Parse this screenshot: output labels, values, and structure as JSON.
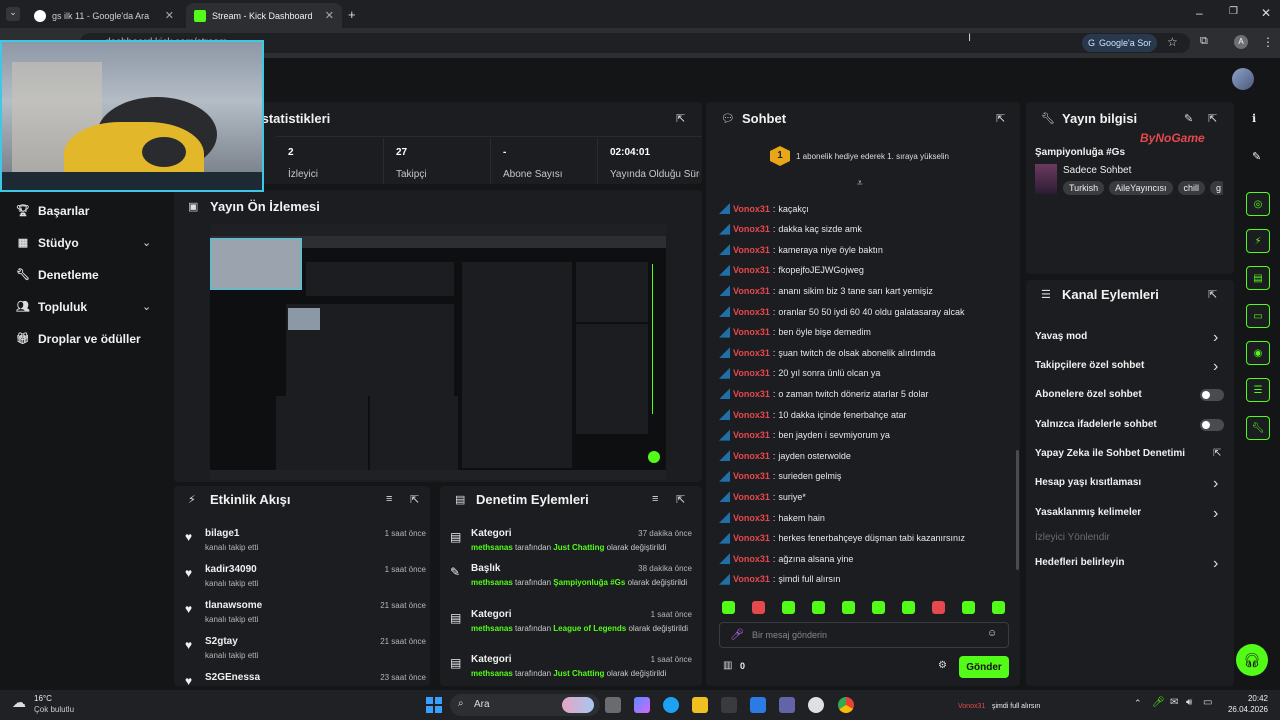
{
  "browser": {
    "tabs": [
      {
        "label": "gs ilk 11 - Google'da Ara"
      },
      {
        "label": "Stream - Kick Dashboard"
      }
    ],
    "url": "dashboard.kick.com/stream",
    "google_btn": "Google'a Sor",
    "profile_initial": "A"
  },
  "nav": {
    "items": [
      {
        "label": "Başarılar",
        "icon": "trophy-icon"
      },
      {
        "label": "Stüdyo",
        "icon": "studio-icon"
      },
      {
        "label": "Denetleme",
        "icon": "wrench-icon"
      },
      {
        "label": "Topluluk",
        "icon": "people-icon"
      },
      {
        "label": "Droplar ve ödüller",
        "icon": "gift-icon"
      }
    ]
  },
  "stats": {
    "title": "İstatistikleri",
    "items": [
      {
        "value": "2",
        "label": "İzleyici"
      },
      {
        "value": "27",
        "label": "Takipçi"
      },
      {
        "value": "-",
        "label": "Abone Sayısı"
      },
      {
        "value": "02:04:01",
        "label": "Yayında Olduğu Süre"
      }
    ]
  },
  "preview": {
    "title": "Yayın Ön İzlemesi"
  },
  "activity": {
    "title": "Etkinlik Akışı",
    "items": [
      {
        "name": "bilage1",
        "sub": "kanalı takip etti",
        "time": "1 saat önce"
      },
      {
        "name": "kadir34090",
        "sub": "kanalı takip etti",
        "time": "1 saat önce"
      },
      {
        "name": "tlanawsome",
        "sub": "kanalı takip etti",
        "time": "21 saat önce"
      },
      {
        "name": "S2gtay",
        "sub": "kanalı takip etti",
        "time": "21 saat önce"
      },
      {
        "name": "S2GEnessa",
        "sub": "",
        "time": "23 saat önce"
      }
    ]
  },
  "moderation": {
    "title": "Denetim Eylemleri",
    "items": [
      {
        "title": "Kategori",
        "time": "37 dakika önce",
        "user": "methsanas",
        "mid": "tarafından",
        "value": "Just Chatting",
        "end": "olarak değiştirildi"
      },
      {
        "title": "Başlık",
        "time": "38 dakika önce",
        "user": "methsanas",
        "mid": "tarafından",
        "value": "Şampiyonluğa #Gs",
        "end": "olarak değiştirildi"
      },
      {
        "title": "Kategori",
        "time": "1 saat önce",
        "user": "methsanas",
        "mid": "tarafından",
        "value": "League of Legends",
        "end": "olarak değiştirildi"
      },
      {
        "title": "Kategori",
        "time": "1 saat önce",
        "user": "methsanas",
        "mid": "tarafından",
        "value": "Just Chatting",
        "end": "olarak değiştirildi"
      }
    ]
  },
  "chat": {
    "title": "Sohbet",
    "goal": "1 abonelik hediye ederek 1. sıraya yükselin",
    "goal_num": "1",
    "username": "Vonox31",
    "messages": [
      "kaçakçı",
      "dakka kaç sizde amk",
      "kameraya niye öyle baktın",
      "fkopejfoJEJWGojweg",
      "ananı sikim biz 3 tane sarı kart yemişiz",
      "oranlar 50 50 iydi 60 40 oldu galatasaray alcak",
      "ben öyle bişe demedim",
      "şuan twitch de olsak abonelik alırdımda",
      "20 yıl sonra ünlü olcan ya",
      "o zaman twitch döneriz atarlar 5 dolar",
      "10 dakka içinde fenerbahçe atar",
      "ben jayden i sevmiyorum ya",
      "jayden osterwolde",
      "surieden gelmiş",
      "suriye*",
      "hakem hain",
      "herkes fenerbahçeye düşman tabi kazanırsınız",
      "ağzına alsana yine",
      "şimdi full alırsın"
    ],
    "placeholder": "Bir mesaj gönderin",
    "points": "0",
    "send": "Gönder"
  },
  "stream_info": {
    "title": "Yayın bilgisi",
    "stream_title": "Şampiyonluğa #Gs",
    "category": "Sadece Sohbet",
    "tags": [
      "Turkish",
      "AileYayıncısı",
      "chill",
      "g"
    ],
    "watermark": "ByNoGame"
  },
  "channel_actions": {
    "title": "Kanal Eylemleri",
    "items": [
      {
        "label": "Yavaş mod",
        "kind": "chevron"
      },
      {
        "label": "Takipçilere özel sohbet",
        "kind": "chevron"
      },
      {
        "label": "Abonelere özel sohbet",
        "kind": "toggle"
      },
      {
        "label": "Yalnızca ifadelerle sohbet",
        "kind": "toggle"
      },
      {
        "label": "Yapay Zeka ile Sohbet Denetimi",
        "kind": "external"
      },
      {
        "label": "Hesap yaşı kısıtlaması",
        "kind": "chevron"
      },
      {
        "label": "Yasaklanmış kelimeler",
        "kind": "chevron"
      },
      {
        "label": "İzleyici Yönlendir",
        "kind": "disabled"
      },
      {
        "label": "Hedefleri belirleyin",
        "kind": "chevron"
      }
    ]
  },
  "taskbar": {
    "weather_temp": "16°C",
    "weather_desc": "Çok bulutlu",
    "search": "Ara",
    "notif_user": "Vonox31",
    "notif_msg": "şimdi full alırsın",
    "time": "20:42",
    "date": "26.04.2026"
  }
}
